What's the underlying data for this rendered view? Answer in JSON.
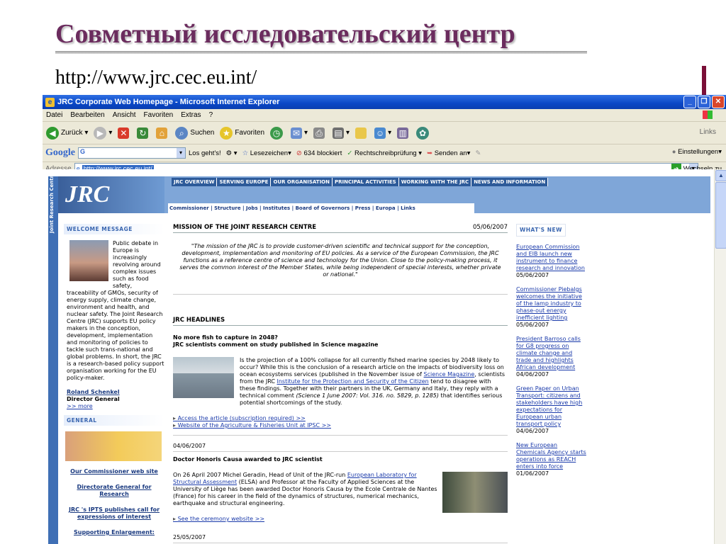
{
  "slide": {
    "title": "Совметный исследовательский центр",
    "url": "http://www.jrc.cec.eu.int/"
  },
  "browser": {
    "window_title": "JRC Corporate Web Homepage - Microsoft Internet Explorer",
    "menu": [
      "Datei",
      "Bearbeiten",
      "Ansicht",
      "Favoriten",
      "Extras",
      "?"
    ],
    "toolbar": {
      "back": "Zurück",
      "search": "Suchen",
      "favorites": "Favoriten",
      "links": "Links"
    },
    "google": {
      "logo": "Google",
      "search_value": "G",
      "go": "Los geht's!",
      "bookmarks": "Lesezeichen",
      "blocked": "634 blockiert",
      "spellcheck": "Rechtschreibprüfung",
      "send": "Senden an",
      "settings": "Einstellungen"
    },
    "address": {
      "label": "Adresse",
      "value": "http://www.jrc.cec.eu.int/",
      "go": "Wechseln zu"
    }
  },
  "site": {
    "side_label": "Joint Research Centre",
    "logo": "JRC",
    "top_nav": [
      "JRC OVERVIEW",
      "SERVING EUROPE",
      "OUR ORGANISATION",
      "PRINCIPAL ACTIVITIES",
      "WORKING WITH THE JRC",
      "NEWS AND INFORMATION"
    ],
    "sub_nav": "Commissioner | Structure | Jobs | Institutes | Board of Governors | Press | Europa | Links",
    "welcome": {
      "heading": "WELCOME MESSAGE",
      "text": "Public debate in Europe is increasingly revolving around complex issues such as food safety, traceability of GMOs, security of energy supply, climate change, environment and health, and nuclear safety. The Joint Research Centre (JRC) supports EU policy makers in the conception, development, implementation and monitoring of policies to tackle such trans-national and global problems. In short, the JRC is a research-based policy support organisation working for the EU policy-maker.",
      "name": "Roland Schenkel",
      "role": "Director General",
      "more": ">> more"
    },
    "general": {
      "heading": "GENERAL",
      "links": [
        "Our Commissioner web site",
        "Directorate General for Research",
        "JRC 's IPTS publishes call for expressions of interest",
        "Supporting Enlargement:"
      ]
    },
    "mission": {
      "title": "MISSION OF THE JOINT RESEARCH CENTRE",
      "date": "05/06/2007",
      "text": "\"The mission of the JRC is to provide customer-driven scientific and technical support for the conception, development, implementation and monitoring of EU policies. As a service of the European Commission, the JRC functions as a reference centre of science and technology for the Union. Close to the policy-making process, it serves the common interest of the Member States, while being independent of special interests, whether private or national.\""
    },
    "headlines": {
      "title": "JRC HEADLINES",
      "story1": {
        "title1": "No more fish to capture in 2048?",
        "title2": "JRC scientists comment on study published in Science magazine",
        "body_a": "Is the projection of a 100% collapse for all currently fished marine species by 2048 likely to occur? While this is the conclusion of a research article on the impacts of biodiversity loss on ocean ecosystems services (published in the November issue of ",
        "link_a": "Science Magazine",
        "body_b": ", scientists from the JRC ",
        "link_b": "Institute for the Protection and Security of the Citizen",
        "body_c": " tend to disagree with these findings. Together with their partners in the UK, Germany and Italy, they reply with a technical comment ",
        "citation": "(Science 1 June 2007: Vol. 316. no. 5829, p. 1285)",
        "body_d": " that identifies serious potential shortcomings of the study.",
        "bullets": [
          "Access the article (subscription required) >>",
          "Website of the Agriculture & Fisheries Unit at IPSC >>"
        ]
      },
      "date2": "04/06/2007",
      "story2": {
        "title": "Doctor Honoris Causa awarded to JRC scientist",
        "body_a": "On 26 April 2007 Michel Geradin, Head of Unit of the JRC-run ",
        "link": "European Laboratory for Structural Assessment",
        "body_b": " (ELSA) and Professor at the Faculty of Applied Sciences at the University of Liège has been awarded Doctor Honoris Causa by the Ecole Centrale de Nantes (France) for his career in the field of the dynamics of structures, numerical mechanics, earthquake and structural engineering.",
        "bullet": "See the ceremony website >>"
      },
      "date3": "25/05/2007"
    },
    "whats_new": {
      "heading": "WHAT'S NEW",
      "items": [
        {
          "title": "European Commission and EIB launch new instrument to finance research and innovation",
          "date": "05/06/2007"
        },
        {
          "title": "Commissioner Piebalgs welcomes the initiative of the lamp industry to phase-out energy inefficient lighting",
          "date": "05/06/2007"
        },
        {
          "title": "President Barroso calls for G8 progress on climate change and trade and highlights African development",
          "date": "04/06/2007"
        },
        {
          "title": "Green Paper on Urban Transport: citizens and stakeholders have high expectations for European urban transport policy",
          "date": "04/06/2007"
        },
        {
          "title": "New European Chemicals Agency starts operations as REACH enters into force",
          "date": "01/06/2007"
        }
      ]
    }
  }
}
